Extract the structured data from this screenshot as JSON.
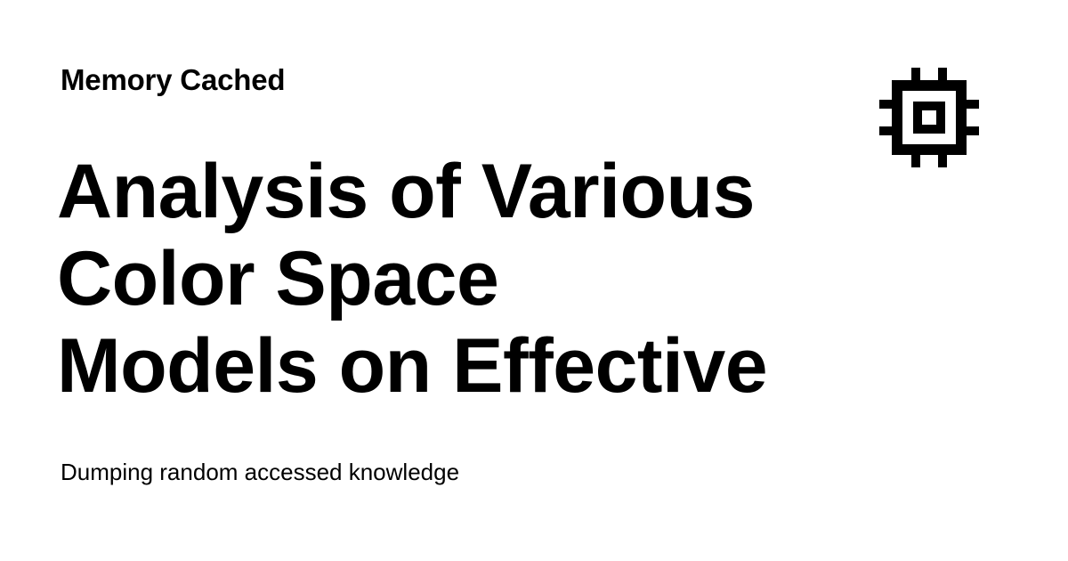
{
  "site": {
    "name": "Memory Cached"
  },
  "post": {
    "title_lines": [
      "Analysis of Various",
      "Color Space",
      "Models on Effective"
    ]
  },
  "tagline": "Dumping random accessed knowledge",
  "logo": {
    "icon": "cpu-chip-icon",
    "color": "#000000"
  },
  "colors": {
    "background": "#ffffff",
    "text": "#000000"
  }
}
